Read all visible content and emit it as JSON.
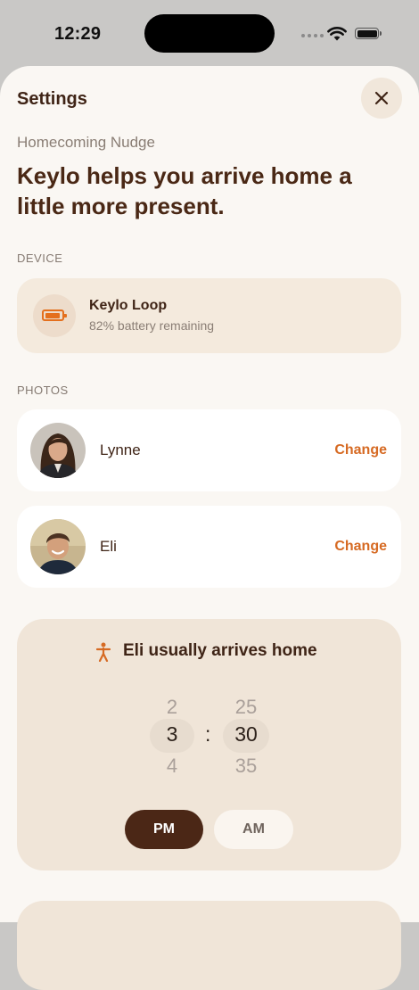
{
  "status_bar": {
    "time": "12:29"
  },
  "sheet": {
    "title": "Settings",
    "subtitle": "Homecoming Nudge",
    "headline": "Keylo helps you arrive home a little more present."
  },
  "device_section": {
    "label": "DEVICE",
    "device_name": "Keylo Loop",
    "device_status": "82% battery remaining",
    "battery_level": 0.82
  },
  "photos_section": {
    "label": "PHOTOS",
    "people": [
      {
        "name": "Lynne",
        "action": "Change"
      },
      {
        "name": "Eli",
        "action": "Change"
      }
    ]
  },
  "arrival": {
    "title": "Eli usually arrives home",
    "hours": [
      "2",
      "3",
      "4"
    ],
    "minutes": [
      "25",
      "30",
      "35"
    ],
    "separator": ":",
    "pm_label": "PM",
    "am_label": "AM",
    "selected_period": "PM"
  },
  "colors": {
    "accent": "#d66a23",
    "dark_brown": "#4b2716",
    "card_tan": "#f0e5d8"
  }
}
